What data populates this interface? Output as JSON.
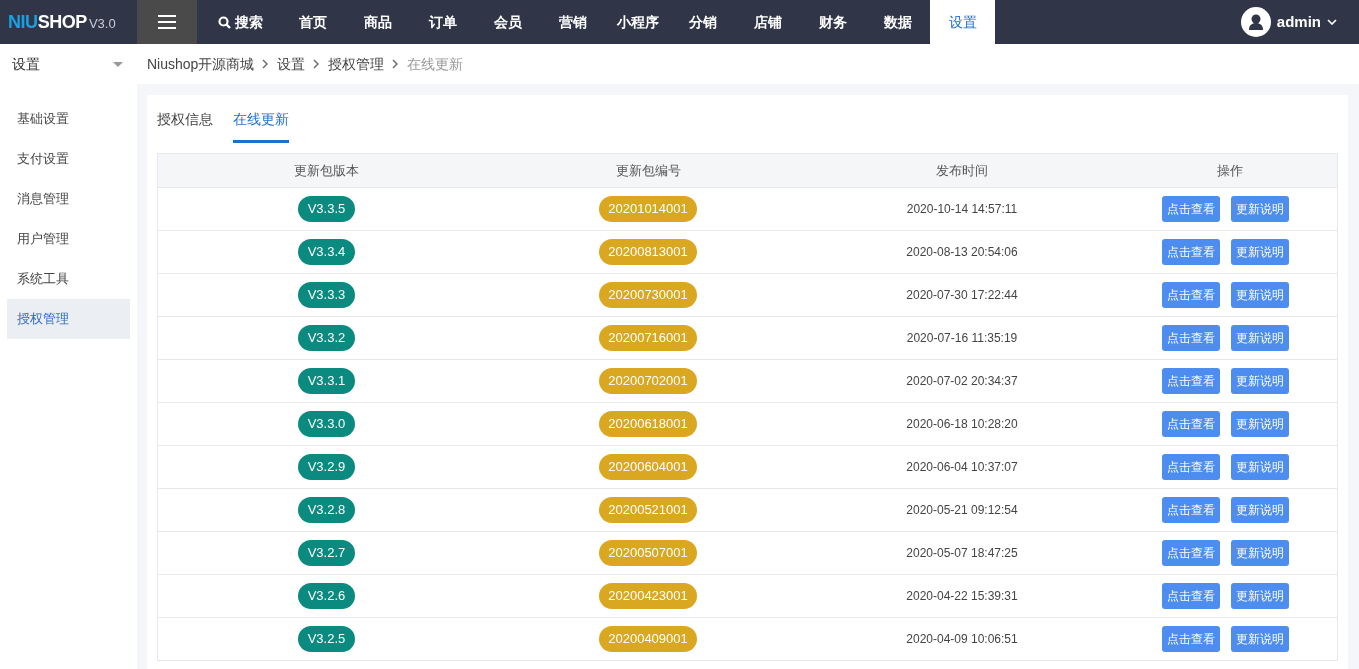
{
  "logo": {
    "brand_part_1": "NIU",
    "brand_part_2": "SHOP",
    "version": "V3.0"
  },
  "search": {
    "label": "搜索"
  },
  "nav": [
    {
      "label": "首页",
      "selected": false
    },
    {
      "label": "商品",
      "selected": false
    },
    {
      "label": "订单",
      "selected": false
    },
    {
      "label": "会员",
      "selected": false
    },
    {
      "label": "营销",
      "selected": false
    },
    {
      "label": "小程序",
      "selected": false
    },
    {
      "label": "分销",
      "selected": false
    },
    {
      "label": "店铺",
      "selected": false
    },
    {
      "label": "财务",
      "selected": false
    },
    {
      "label": "数据",
      "selected": false
    },
    {
      "label": "设置",
      "selected": true
    }
  ],
  "user": {
    "name": "admin"
  },
  "sidebar": {
    "title": "设置",
    "items": [
      {
        "label": "基础设置",
        "selected": false
      },
      {
        "label": "支付设置",
        "selected": false
      },
      {
        "label": "消息管理",
        "selected": false
      },
      {
        "label": "用户管理",
        "selected": false
      },
      {
        "label": "系统工具",
        "selected": false
      },
      {
        "label": "授权管理",
        "selected": true
      }
    ]
  },
  "breadcrumb": [
    "Niushop开源商城",
    "设置",
    "授权管理",
    "在线更新"
  ],
  "tabs": [
    {
      "label": "授权信息",
      "selected": false
    },
    {
      "label": "在线更新",
      "selected": true
    }
  ],
  "table": {
    "columns": [
      "更新包版本",
      "更新包编号",
      "发布时间",
      "操作"
    ],
    "rows": [
      {
        "version": "V3.3.5",
        "package": "20201014001",
        "time": "2020-10-14 14:57:11",
        "actions": [
          "点击查看",
          "更新说明"
        ]
      },
      {
        "version": "V3.3.4",
        "package": "20200813001",
        "time": "2020-08-13 20:54:06",
        "actions": [
          "点击查看",
          "更新说明"
        ]
      },
      {
        "version": "V3.3.3",
        "package": "20200730001",
        "time": "2020-07-30 17:22:44",
        "actions": [
          "点击查看",
          "更新说明"
        ]
      },
      {
        "version": "V3.3.2",
        "package": "20200716001",
        "time": "2020-07-16 11:35:19",
        "actions": [
          "点击查看",
          "更新说明"
        ]
      },
      {
        "version": "V3.3.1",
        "package": "20200702001",
        "time": "2020-07-02 20:34:37",
        "actions": [
          "点击查看",
          "更新说明"
        ]
      },
      {
        "version": "V3.3.0",
        "package": "20200618001",
        "time": "2020-06-18 10:28:20",
        "actions": [
          "点击查看",
          "更新说明"
        ]
      },
      {
        "version": "V3.2.9",
        "package": "20200604001",
        "time": "2020-06-04 10:37:07",
        "actions": [
          "点击查看",
          "更新说明"
        ]
      },
      {
        "version": "V3.2.8",
        "package": "20200521001",
        "time": "2020-05-21 09:12:54",
        "actions": [
          "点击查看",
          "更新说明"
        ]
      },
      {
        "version": "V3.2.7",
        "package": "20200507001",
        "time": "2020-05-07 18:47:25",
        "actions": [
          "点击查看",
          "更新说明"
        ]
      },
      {
        "version": "V3.2.6",
        "package": "20200423001",
        "time": "2020-04-22 15:39:31",
        "actions": [
          "点击查看",
          "更新说明"
        ]
      },
      {
        "version": "V3.2.5",
        "package": "20200409001",
        "time": "2020-04-09 10:06:51",
        "actions": [
          "点击查看",
          "更新说明"
        ]
      }
    ]
  }
}
